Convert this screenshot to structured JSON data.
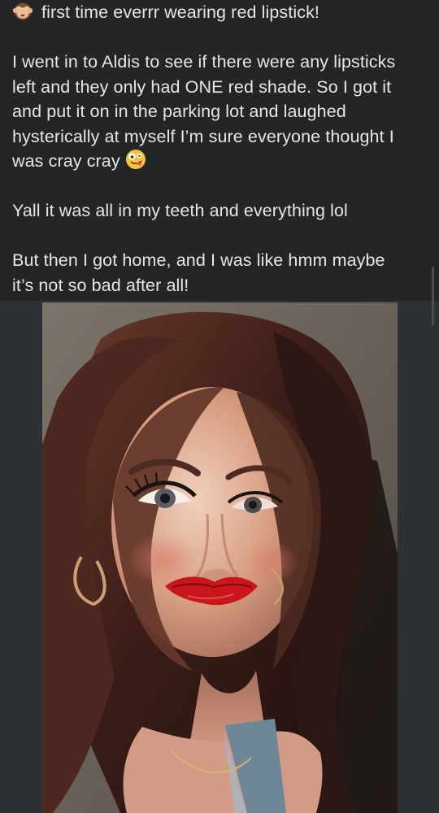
{
  "post": {
    "title_emoji": "see-no-evil-monkey-icon",
    "title": "first time everrr wearing red lipstick!",
    "paragraph1_lines": [
      "I went in to Aldis to see if there were any lipsticks",
      "left and they only had ONE red shade. So I got it",
      "and put it on in the parking lot and laughed",
      "hysterically at myself I’m sure everyone thought I",
      "was cray cray"
    ],
    "paragraph1_emoji": "zany-face-icon",
    "paragraph2": "Yall it was all in my teeth and everything lol",
    "paragraph3_lines": [
      "But then I got home, and I was like hmm maybe",
      "it’s not so bad after all!"
    ]
  },
  "photo": {
    "subject": "selfie-photo"
  },
  "colors": {
    "post_background": "#242526",
    "page_background": "#2d3034",
    "text": "#e6e6e6",
    "lipstick": "#c8161b"
  }
}
